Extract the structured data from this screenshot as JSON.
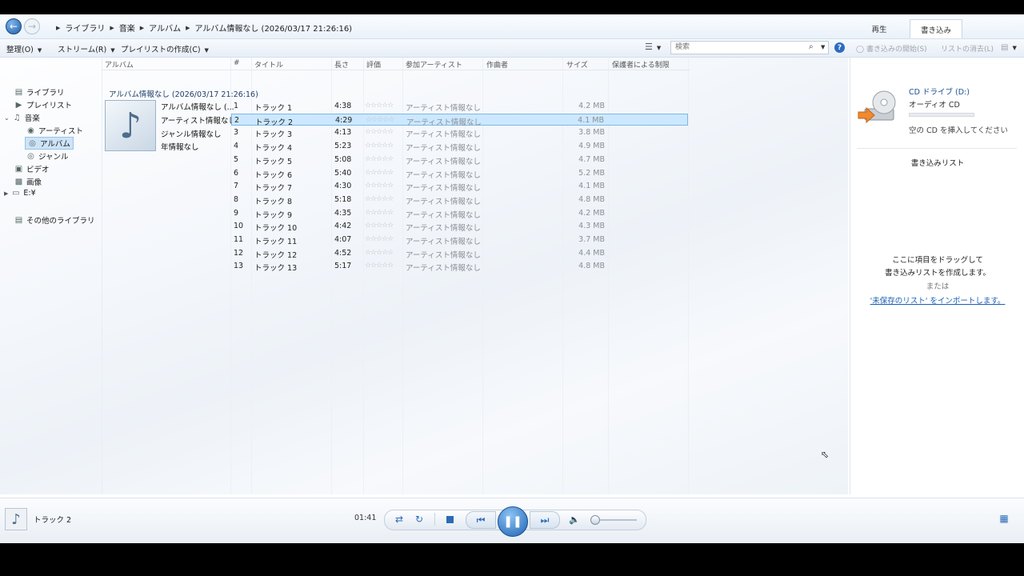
{
  "breadcrumb": [
    "ライブラリ",
    "音楽",
    "アルバム",
    "アルバム情報なし (2026/03/17 21:26:16)"
  ],
  "right_tabs": {
    "play": "再生",
    "burn": "書き込み"
  },
  "menu": {
    "organize": "整理(O)",
    "stream": "ストリーム(R)",
    "create_playlist": "プレイリストの作成(C)"
  },
  "search": {
    "placeholder": "検索"
  },
  "right_cmds": {
    "start_burn": "書き込みの開始(S)",
    "clear_list": "リストの消去(L)"
  },
  "nav": {
    "library": "ライブラリ",
    "playlists": "プレイリスト",
    "music": "音楽",
    "artist": "アーティスト",
    "album": "アルバム",
    "genre": "ジャンル",
    "video": "ビデオ",
    "pictures": "画像",
    "drive": "E:¥",
    "other_libraries": "その他のライブラリ"
  },
  "columns": {
    "album": "アルバム",
    "num": "#",
    "title": "タイトル",
    "length": "長さ",
    "rating": "評価",
    "artist": "参加アーティスト",
    "composer": "作曲者",
    "size": "サイズ",
    "parental": "保護者による制限"
  },
  "album": {
    "group_title": "アルバム情報なし (2026/03/17 21:26:16)",
    "meta": [
      "アルバム情報なし (...",
      "アーティスト情報なし",
      "ジャンル情報なし",
      "年情報なし"
    ]
  },
  "tracks": [
    {
      "num": "1",
      "title": "トラック 1",
      "length": "4:38",
      "artist": "アーティスト情報なし",
      "size": "4.2 MB"
    },
    {
      "num": "2",
      "title": "トラック 2",
      "length": "4:29",
      "artist": "アーティスト情報なし",
      "size": "4.1 MB"
    },
    {
      "num": "3",
      "title": "トラック 3",
      "length": "4:13",
      "artist": "アーティスト情報なし",
      "size": "3.8 MB"
    },
    {
      "num": "4",
      "title": "トラック 4",
      "length": "5:23",
      "artist": "アーティスト情報なし",
      "size": "4.9 MB"
    },
    {
      "num": "5",
      "title": "トラック 5",
      "length": "5:08",
      "artist": "アーティスト情報なし",
      "size": "4.7 MB"
    },
    {
      "num": "6",
      "title": "トラック 6",
      "length": "5:40",
      "artist": "アーティスト情報なし",
      "size": "5.2 MB"
    },
    {
      "num": "7",
      "title": "トラック 7",
      "length": "4:30",
      "artist": "アーティスト情報なし",
      "size": "4.1 MB"
    },
    {
      "num": "8",
      "title": "トラック 8",
      "length": "5:18",
      "artist": "アーティスト情報なし",
      "size": "4.8 MB"
    },
    {
      "num": "9",
      "title": "トラック 9",
      "length": "4:35",
      "artist": "アーティスト情報なし",
      "size": "4.2 MB"
    },
    {
      "num": "10",
      "title": "トラック 10",
      "length": "4:42",
      "artist": "アーティスト情報なし",
      "size": "4.3 MB"
    },
    {
      "num": "11",
      "title": "トラック 11",
      "length": "4:07",
      "artist": "アーティスト情報なし",
      "size": "3.7 MB"
    },
    {
      "num": "12",
      "title": "トラック 12",
      "length": "4:52",
      "artist": "アーティスト情報なし",
      "size": "4.4 MB"
    },
    {
      "num": "13",
      "title": "トラック 13",
      "length": "5:17",
      "artist": "アーティスト情報なし",
      "size": "4.8 MB"
    }
  ],
  "selected_track_index": 1,
  "burn_panel": {
    "drive_name": "CD ドライブ (D:)",
    "disc_type": "オーディオ CD",
    "insert_msg": "空の CD を挿入してください",
    "list_title": "書き込みリスト",
    "drag_msg_1": "ここに項目をドラッグして",
    "drag_msg_2": "書き込みリストを作成します。",
    "or": "または",
    "import_link": "'未保存のリスト' をインポートします。"
  },
  "player": {
    "now_playing": "トラック 2",
    "elapsed": "01:41",
    "progress_fraction": 0.385,
    "volume_fraction": 0.0
  },
  "colors": {
    "accent": "#2b78c8",
    "selection": "#cce8ff",
    "link": "#1a5fb4"
  }
}
